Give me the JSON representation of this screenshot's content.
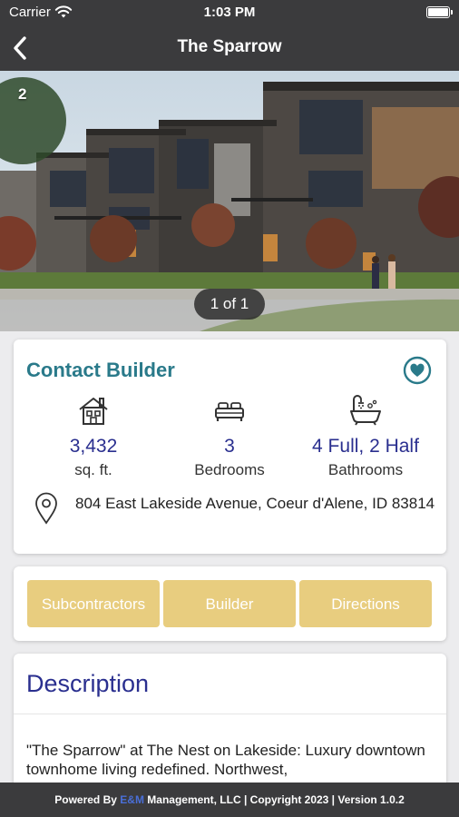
{
  "status_bar": {
    "carrier": "Carrier",
    "time": "1:03 PM"
  },
  "nav": {
    "title": "The Sparrow"
  },
  "hero": {
    "counter": "2",
    "pager": "1 of 1"
  },
  "info": {
    "contact_label": "Contact Builder",
    "stats": {
      "sqft_value": "3,432",
      "sqft_label": "sq. ft.",
      "bed_value": "3",
      "bed_label": "Bedrooms",
      "bath_value": "4 Full, 2 Half",
      "bath_label": "Bathrooms"
    },
    "address": "804 East Lakeside Avenue, Coeur d'Alene, ID 83814"
  },
  "actions": {
    "subcontractors": "Subcontractors",
    "builder": "Builder",
    "directions": "Directions"
  },
  "description": {
    "heading": "Description",
    "text": "\"The Sparrow\" at The Nest on Lakeside: Luxury downtown townhome living redefined. Northwest,"
  },
  "footer": {
    "prefix": "Powered By ",
    "em": "E&M",
    "suffix": " Management, LLC | Copyright 2023 | Version 1.0.2"
  },
  "colors": {
    "bar": "#3b3b3d",
    "accent_teal": "#2a7a8a",
    "value_navy": "#2a2f8f",
    "button_gold": "#e8cd7f"
  },
  "icons": {
    "back": "chevron-left-icon",
    "favorite": "heart-icon",
    "sqft": "house-icon",
    "bed": "bed-icon",
    "bath": "bathtub-icon",
    "address": "map-pin-icon"
  }
}
